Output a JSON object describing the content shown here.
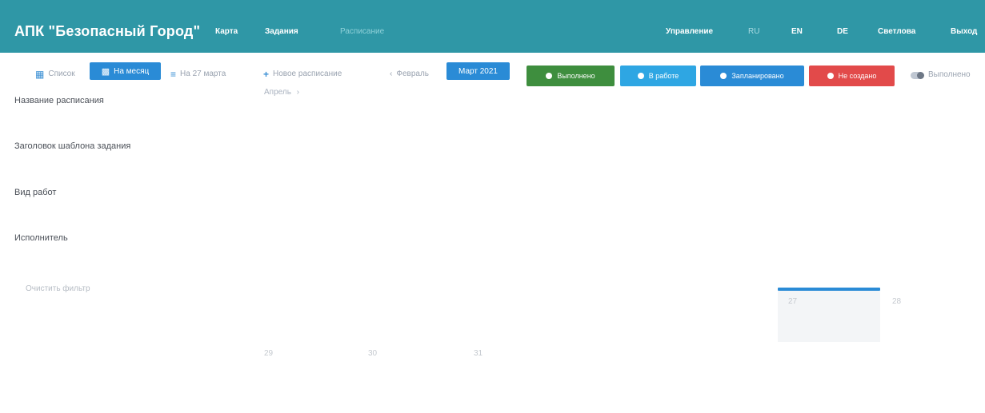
{
  "header": {
    "brand": "АПК \"Безопасный Город\"",
    "nav": [
      "Карта",
      "Задания",
      "Расписание"
    ],
    "right": {
      "management": "Управление",
      "lang_ru": "RU",
      "lang_en": "EN",
      "lang_de": "DE",
      "user": "Светлова",
      "logout": "Выход"
    }
  },
  "toolbar": {
    "list": "Список",
    "month": "На месяц",
    "day": "На 27 марта",
    "new_schedule": "Новое расписание",
    "prev_month": "Февраль",
    "current_month": "Март 2021",
    "statuses": {
      "done": "Выполнено",
      "in_progress": "В работе",
      "planned": "Запланировано",
      "not_created": "Не создано"
    },
    "toggle_label": "Выполнено"
  },
  "colors": {
    "header_bg": "#2f97a6",
    "primary": "#2a8bd6",
    "done": "#3e8e3e",
    "in_progress": "#2ea6e3",
    "planned": "#2a8bd6",
    "not_created": "#e24a4a"
  },
  "filters": {
    "schedule_name": "Название расписания",
    "template_title": "Заголовок шаблона задания",
    "work_type": "Вид работ",
    "executor": "Исполнитель",
    "clear": "Очистить фильтр"
  },
  "calendar": {
    "next_month": "Апрель",
    "rows": [
      [
        "",
        "",
        "",
        "",
        "",
        "",
        "",
        ""
      ],
      [
        "",
        "",
        "",
        "",
        "",
        "",
        "",
        ""
      ],
      [
        "",
        "",
        "",
        "",
        "",
        "",
        "",
        ""
      ],
      [
        "",
        "",
        "",
        "",
        "",
        "",
        "27",
        "28"
      ],
      [
        "29",
        "30",
        "31",
        "",
        "",
        "",
        "",
        ""
      ]
    ]
  }
}
